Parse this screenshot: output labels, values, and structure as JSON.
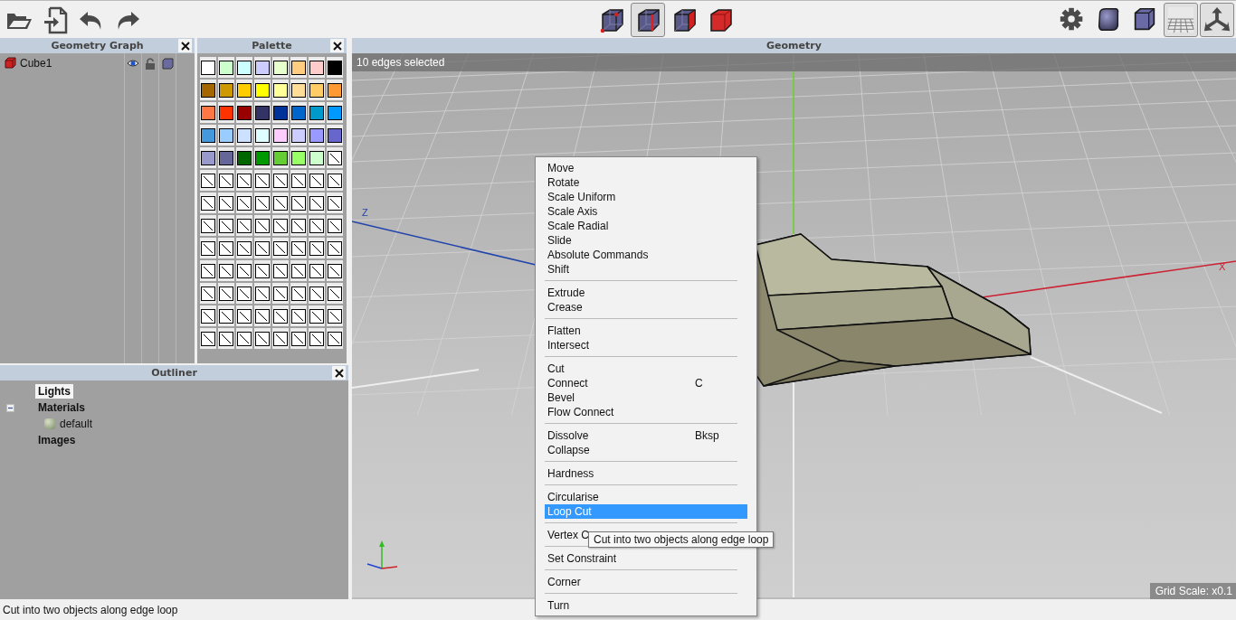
{
  "toolbar": {
    "file_tools": [
      {
        "kind": "open"
      },
      {
        "kind": "import"
      },
      {
        "kind": "undo"
      },
      {
        "kind": "redo"
      }
    ],
    "select_modes": [
      {
        "kind": "vertex",
        "selected": false
      },
      {
        "kind": "edge",
        "selected": true
      },
      {
        "kind": "face",
        "selected": false
      },
      {
        "kind": "body",
        "selected": false
      }
    ],
    "view_tools": [
      {
        "kind": "settings",
        "on": false
      },
      {
        "kind": "smooth",
        "on": false
      },
      {
        "kind": "flat",
        "on": false
      },
      {
        "kind": "ground",
        "on": true
      },
      {
        "kind": "axes",
        "on": true
      }
    ]
  },
  "geometry_graph": {
    "title": "Geometry Graph",
    "objects": [
      {
        "name": "Cube1",
        "visible": true,
        "locked": false
      }
    ]
  },
  "palette": {
    "title": "Palette",
    "swatches": [
      {
        "kind": "color",
        "color": "#ffffff"
      },
      {
        "kind": "color",
        "color": "#ccffcc"
      },
      {
        "kind": "color",
        "color": "#ccffff"
      },
      {
        "kind": "color",
        "color": "#ccccff"
      },
      {
        "kind": "color",
        "color": "#e6ffcc"
      },
      {
        "kind": "color",
        "color": "#ffcc80"
      },
      {
        "kind": "color",
        "color": "#ffcccc"
      },
      {
        "kind": "color",
        "color": "#000000"
      },
      {
        "kind": "color",
        "color": "#a36600"
      },
      {
        "kind": "color",
        "color": "#cc9900"
      },
      {
        "kind": "color",
        "color": "#ffcc00"
      },
      {
        "kind": "color",
        "color": "#ffff00"
      },
      {
        "kind": "color",
        "color": "#ffff99"
      },
      {
        "kind": "color",
        "color": "#ffdd99"
      },
      {
        "kind": "color",
        "color": "#ffcc66"
      },
      {
        "kind": "color",
        "color": "#ff9933"
      },
      {
        "kind": "color",
        "color": "#ff7744"
      },
      {
        "kind": "color",
        "color": "#ff3300"
      },
      {
        "kind": "color",
        "color": "#990000"
      },
      {
        "kind": "color",
        "color": "#333366"
      },
      {
        "kind": "color",
        "color": "#003399"
      },
      {
        "kind": "color",
        "color": "#0066cc"
      },
      {
        "kind": "color",
        "color": "#0099cc"
      },
      {
        "kind": "color",
        "color": "#0099ff"
      },
      {
        "kind": "color",
        "color": "#4499dd"
      },
      {
        "kind": "color",
        "color": "#99ccff"
      },
      {
        "kind": "color",
        "color": "#cce0ff"
      },
      {
        "kind": "color",
        "color": "#ddffff"
      },
      {
        "kind": "color",
        "color": "#ffccff"
      },
      {
        "kind": "color",
        "color": "#ccccff"
      },
      {
        "kind": "color",
        "color": "#9999ff"
      },
      {
        "kind": "color",
        "color": "#6666cc"
      },
      {
        "kind": "color",
        "color": "#9999cc"
      },
      {
        "kind": "color",
        "color": "#666699"
      },
      {
        "kind": "color",
        "color": "#006600"
      },
      {
        "kind": "color",
        "color": "#009900"
      },
      {
        "kind": "color",
        "color": "#66cc33"
      },
      {
        "kind": "color",
        "color": "#99ff66"
      },
      {
        "kind": "color",
        "color": "#ccffcc"
      },
      {
        "kind": "empty"
      },
      {
        "kind": "empty"
      },
      {
        "kind": "empty"
      },
      {
        "kind": "empty"
      },
      {
        "kind": "empty"
      },
      {
        "kind": "empty"
      },
      {
        "kind": "empty"
      },
      {
        "kind": "empty"
      },
      {
        "kind": "empty"
      },
      {
        "kind": "empty"
      },
      {
        "kind": "empty"
      },
      {
        "kind": "empty"
      },
      {
        "kind": "empty"
      },
      {
        "kind": "empty"
      },
      {
        "kind": "empty"
      },
      {
        "kind": "empty"
      },
      {
        "kind": "empty"
      },
      {
        "kind": "empty"
      },
      {
        "kind": "empty"
      },
      {
        "kind": "empty"
      },
      {
        "kind": "empty"
      },
      {
        "kind": "empty"
      },
      {
        "kind": "empty"
      },
      {
        "kind": "empty"
      },
      {
        "kind": "empty"
      },
      {
        "kind": "empty"
      },
      {
        "kind": "empty"
      },
      {
        "kind": "empty"
      },
      {
        "kind": "empty"
      },
      {
        "kind": "empty"
      },
      {
        "kind": "empty"
      },
      {
        "kind": "empty"
      },
      {
        "kind": "empty"
      },
      {
        "kind": "empty"
      },
      {
        "kind": "empty"
      },
      {
        "kind": "empty"
      },
      {
        "kind": "empty"
      },
      {
        "kind": "empty"
      },
      {
        "kind": "empty"
      },
      {
        "kind": "empty"
      },
      {
        "kind": "empty"
      },
      {
        "kind": "empty"
      },
      {
        "kind": "empty"
      },
      {
        "kind": "empty"
      },
      {
        "kind": "empty"
      },
      {
        "kind": "empty"
      },
      {
        "kind": "empty"
      },
      {
        "kind": "empty"
      },
      {
        "kind": "empty"
      },
      {
        "kind": "empty"
      },
      {
        "kind": "empty"
      },
      {
        "kind": "empty"
      },
      {
        "kind": "empty"
      },
      {
        "kind": "empty"
      },
      {
        "kind": "empty"
      },
      {
        "kind": "empty"
      },
      {
        "kind": "empty"
      },
      {
        "kind": "empty"
      },
      {
        "kind": "empty"
      },
      {
        "kind": "empty"
      },
      {
        "kind": "empty"
      },
      {
        "kind": "empty"
      },
      {
        "kind": "empty"
      },
      {
        "kind": "empty"
      },
      {
        "kind": "empty"
      }
    ]
  },
  "outliner": {
    "title": "Outliner",
    "items": [
      {
        "label": "Lights",
        "selected": true,
        "expanded": false
      },
      {
        "label": "Materials",
        "selected": false,
        "expanded": true,
        "children": [
          {
            "label": "default",
            "selected": false,
            "expanded": false
          }
        ]
      },
      {
        "label": "Images",
        "selected": false,
        "expanded": false
      }
    ]
  },
  "geometry": {
    "title": "Geometry",
    "status": "10 edges selected",
    "grid_scale": "Grid Scale: x0.1",
    "axis_labels": [
      "Z",
      "X"
    ],
    "context_menu": [
      {
        "kind": "item",
        "label": "Move",
        "selected": false
      },
      {
        "kind": "item",
        "label": "Rotate",
        "selected": false
      },
      {
        "kind": "item",
        "label": "Scale Uniform",
        "selected": false
      },
      {
        "kind": "item",
        "label": "Scale Axis",
        "selected": false
      },
      {
        "kind": "item",
        "label": "Scale Radial",
        "selected": false
      },
      {
        "kind": "item",
        "label": "Slide",
        "selected": false
      },
      {
        "kind": "item",
        "label": "Absolute Commands",
        "selected": false
      },
      {
        "kind": "item",
        "label": "Shift",
        "selected": false
      },
      {
        "kind": "separator"
      },
      {
        "kind": "item",
        "label": "Extrude",
        "selected": false
      },
      {
        "kind": "item",
        "label": "Crease",
        "selected": false
      },
      {
        "kind": "separator"
      },
      {
        "kind": "item",
        "label": "Flatten",
        "selected": false
      },
      {
        "kind": "item",
        "label": "Intersect",
        "selected": false
      },
      {
        "kind": "separator"
      },
      {
        "kind": "item",
        "label": "Cut",
        "selected": false
      },
      {
        "kind": "item",
        "label": "Connect",
        "shortcut": "C",
        "selected": false
      },
      {
        "kind": "item",
        "label": "Bevel",
        "selected": false
      },
      {
        "kind": "item",
        "label": "Flow Connect",
        "selected": false
      },
      {
        "kind": "separator"
      },
      {
        "kind": "item",
        "label": "Dissolve",
        "shortcut": "Bksp",
        "selected": false
      },
      {
        "kind": "item",
        "label": "Collapse",
        "selected": false
      },
      {
        "kind": "separator"
      },
      {
        "kind": "item",
        "label": "Hardness",
        "selected": false
      },
      {
        "kind": "separator"
      },
      {
        "kind": "item",
        "label": "Circularise",
        "selected": false
      },
      {
        "kind": "item",
        "label": "Loop Cut",
        "selected": true
      },
      {
        "kind": "separator"
      },
      {
        "kind": "item",
        "label": "Vertex C",
        "selected": false
      },
      {
        "kind": "separator"
      },
      {
        "kind": "item",
        "label": "Set Constraint",
        "selected": false
      },
      {
        "kind": "separator"
      },
      {
        "kind": "item",
        "label": "Corner",
        "selected": false
      },
      {
        "kind": "separator"
      },
      {
        "kind": "item",
        "label": "Turn",
        "selected": false
      }
    ],
    "tooltip": "Cut into two objects along edge loop"
  },
  "status_bar": "Cut into two objects along edge loop"
}
